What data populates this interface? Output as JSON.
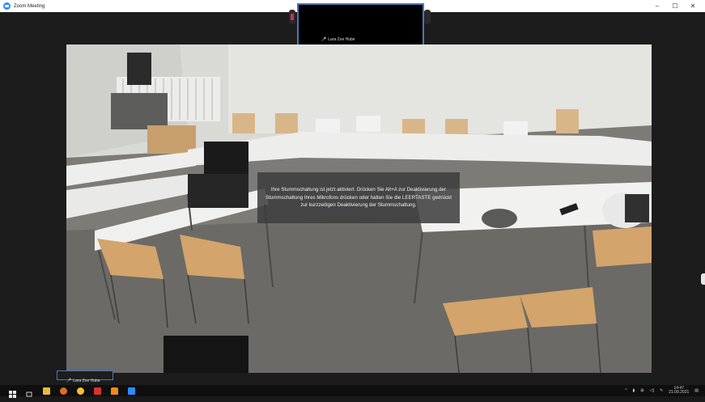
{
  "window": {
    "title": "Zoom Meeting"
  },
  "controls": {
    "minimize": "–",
    "maximize": "☐",
    "close": "✕"
  },
  "thumbnail": {
    "participant_name": "Lara Zoe Hube"
  },
  "self_view": {
    "participant_name": "Lara Zoe Hube"
  },
  "notification": {
    "text": "Ihre Stummschaltung ist jetzt aktiviert. Drücken Sie Alt+A zur Deaktivierung der Stummschaltung Ihres Mikrofons drücken oder halten Sie die LEERTASTE gedrückt zur kurzzeitigen Deaktivierung der Stummschaltung."
  },
  "taskbar": {
    "clock_time": "14:47",
    "clock_date": "21.09.2021"
  },
  "colors": {
    "accent": "#4a78b5",
    "zoom_blue": "#2d8cff",
    "muted_red": "#e02828"
  }
}
